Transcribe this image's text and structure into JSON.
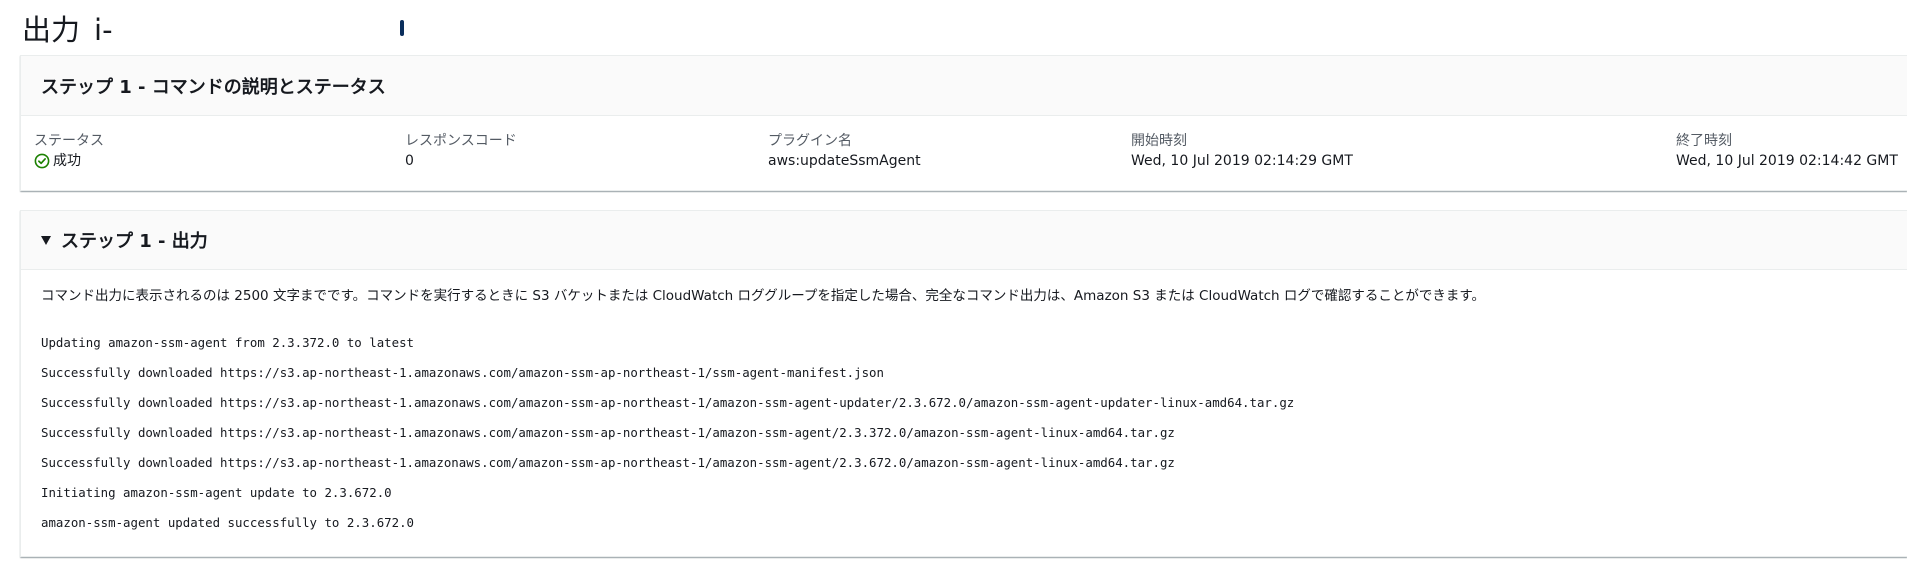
{
  "page": {
    "title_prefix": "出力",
    "instance_id": "i-"
  },
  "step_status": {
    "title": "ステップ 1 - コマンドの説明とステータス",
    "fields": {
      "status_label": "ステータス",
      "status_value": "成功",
      "response_code_label": "レスポンスコード",
      "response_code_value": "0",
      "plugin_label": "プラグイン名",
      "plugin_value": "aws:updateSsmAgent",
      "start_label": "開始時刻",
      "start_value": "Wed, 10 Jul 2019 02:14:29 GMT",
      "end_label": "終了時刻",
      "end_value": "Wed, 10 Jul 2019 02:14:42 GMT"
    },
    "status_icon": "check-circle-icon",
    "status_color": "#1d8102"
  },
  "step_output": {
    "title": "ステップ 1 - 出力",
    "toggle_icon": "caret-down-icon",
    "note": "コマンド出力に表示されるのは 2500 文字までです。コマンドを実行するときに S3 バケットまたは CloudWatch ロググループを指定した場合、完全なコマンド出力は、Amazon S3 または CloudWatch ログで確認することができます。",
    "lines": [
      "Updating amazon-ssm-agent from 2.3.372.0 to latest",
      "Successfully downloaded https://s3.ap-northeast-1.amazonaws.com/amazon-ssm-ap-northeast-1/ssm-agent-manifest.json",
      "Successfully downloaded https://s3.ap-northeast-1.amazonaws.com/amazon-ssm-ap-northeast-1/amazon-ssm-agent-updater/2.3.672.0/amazon-ssm-agent-updater-linux-amd64.tar.gz",
      "Successfully downloaded https://s3.ap-northeast-1.amazonaws.com/amazon-ssm-ap-northeast-1/amazon-ssm-agent/2.3.372.0/amazon-ssm-agent-linux-amd64.tar.gz",
      "Successfully downloaded https://s3.ap-northeast-1.amazonaws.com/amazon-ssm-ap-northeast-1/amazon-ssm-agent/2.3.672.0/amazon-ssm-agent-linux-amd64.tar.gz",
      "Initiating amazon-ssm-agent update to 2.3.672.0",
      "amazon-ssm-agent updated successfully to 2.3.672.0"
    ]
  }
}
